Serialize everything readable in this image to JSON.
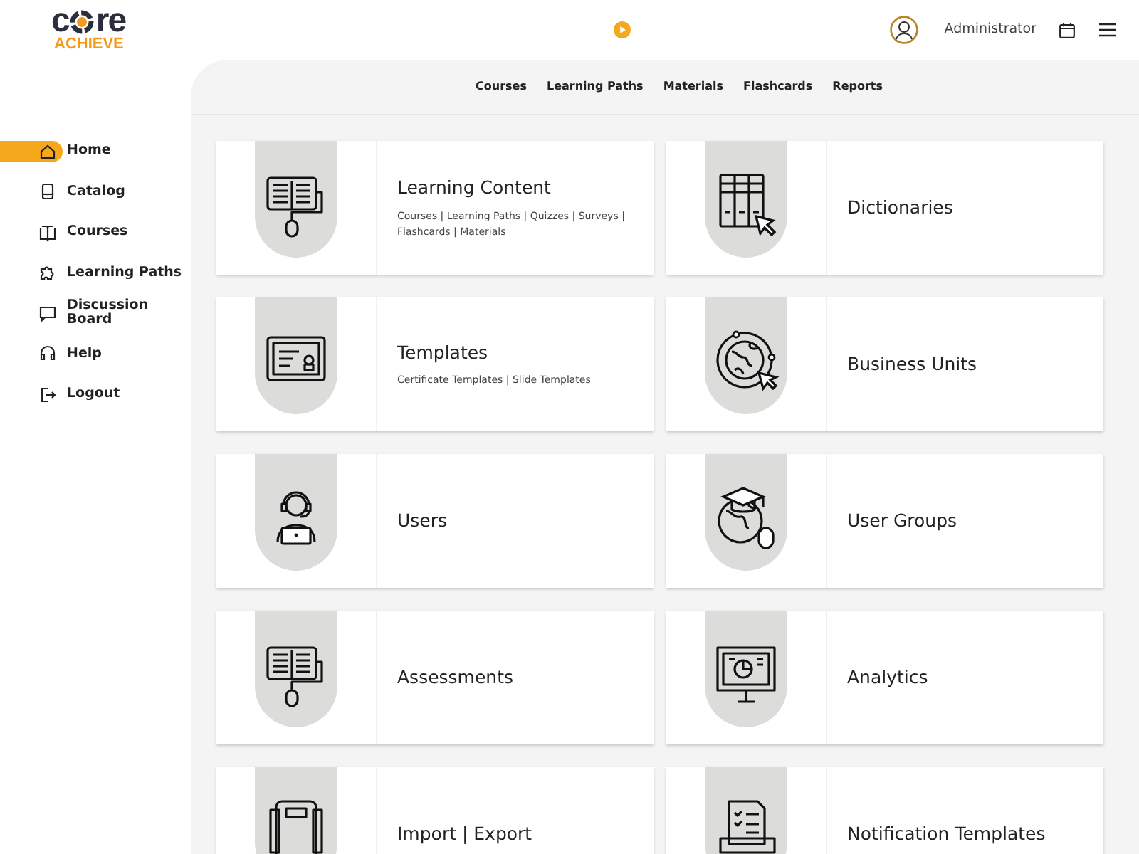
{
  "header": {
    "logo_left": "c",
    "logo_right": "re",
    "logo_bottom": "ACHIEVE",
    "user": "Administrator"
  },
  "sidebar": {
    "items": [
      {
        "label": "Home",
        "selected": true
      },
      {
        "label": "Catalog",
        "selected": false
      },
      {
        "label": "Courses",
        "selected": false
      },
      {
        "label": "Learning Paths",
        "selected": false
      },
      {
        "label": "Discussion Board",
        "selected": false
      },
      {
        "label": "Help",
        "selected": false
      },
      {
        "label": "Logout",
        "selected": false
      }
    ]
  },
  "subnav": [
    "Courses",
    "Learning Paths",
    "Materials",
    "Flashcards",
    "Reports"
  ],
  "cards": [
    {
      "title": "Learning Content",
      "links": "Courses | Learning Paths | Quizzes | Surveys | Flashcards | Materials"
    },
    {
      "title": "Dictionaries"
    },
    {
      "title": "Templates",
      "links": "Certificate Templates | Slide Templates"
    },
    {
      "title": "Business Units"
    },
    {
      "title": "Users"
    },
    {
      "title": "User Groups"
    },
    {
      "title": "Assessments"
    },
    {
      "title": "Analytics"
    },
    {
      "title": "Import | Export"
    },
    {
      "title": "Notification Templates"
    }
  ]
}
